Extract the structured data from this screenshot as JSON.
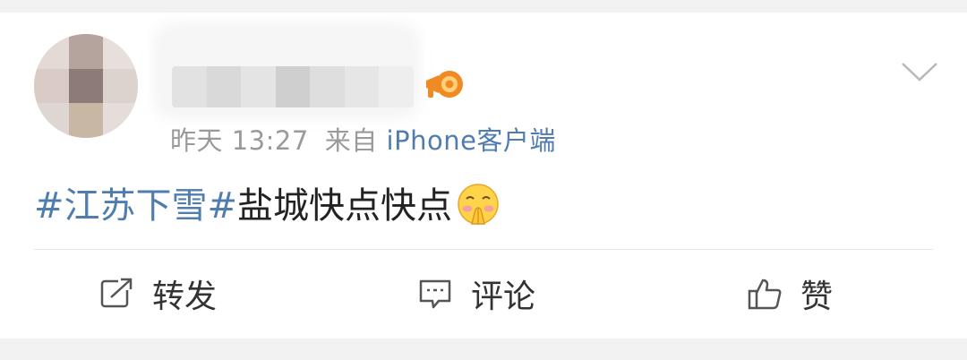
{
  "post": {
    "timestamp": "昨天 13:27",
    "from_label": "来自",
    "source": "iPhone客户端",
    "topic": "#江苏下雪#",
    "text": "盐城快点快点",
    "emoji": "shushing-blush-emoji"
  },
  "actions": {
    "repost_label": "转发",
    "comment_label": "评论",
    "like_label": "赞"
  },
  "icons": {
    "megaphone": "megaphone-icon",
    "chevron": "chevron-down-icon",
    "repost": "share-icon",
    "comment": "comment-icon",
    "like": "thumbs-up-icon"
  },
  "colors": {
    "link": "#507daf",
    "text": "#222222",
    "meta": "#9a9a9a",
    "background": "#f2f2f2"
  }
}
